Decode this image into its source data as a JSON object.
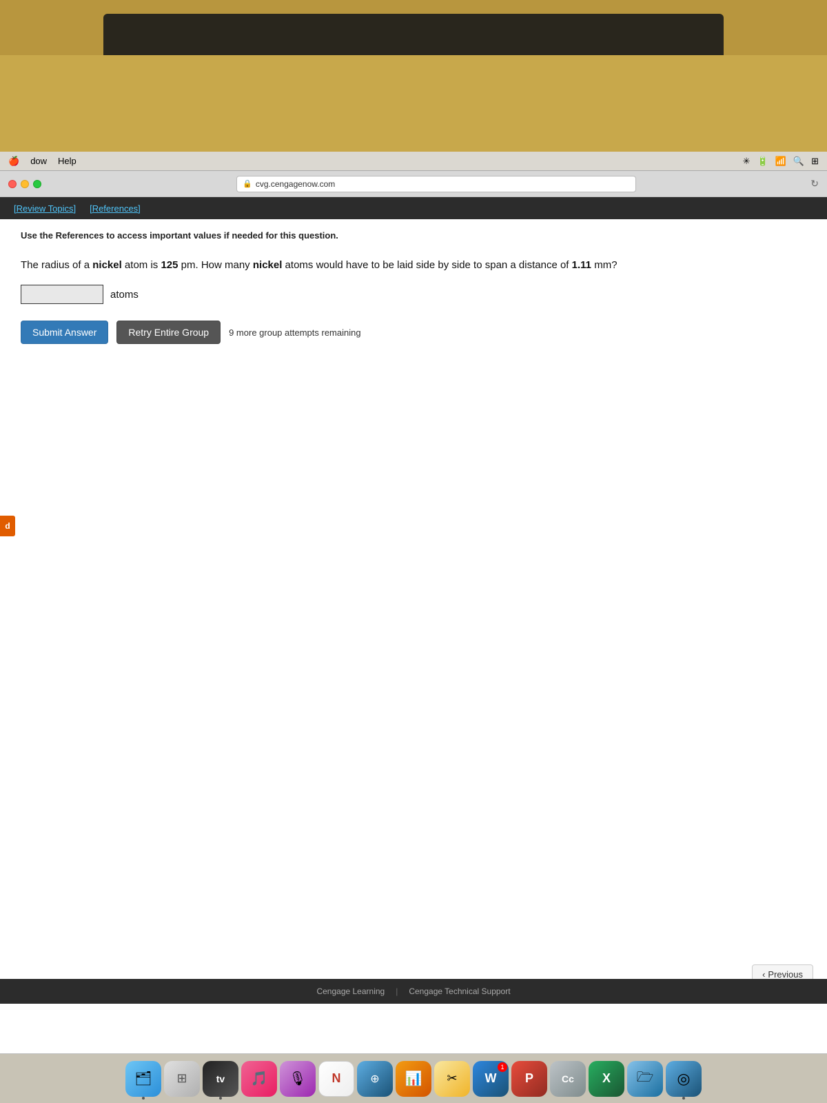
{
  "desktop": {
    "background_color": "#c8a84b"
  },
  "menubar": {
    "items": [
      "dow",
      "Help"
    ],
    "right_items": [
      "battery_icon",
      "wifi_icon",
      "search_icon",
      "control_center_icon"
    ]
  },
  "browser": {
    "address": "cvg.cengagenow.com",
    "nav_links": {
      "review_topics": "[Review Topics]",
      "references": "[References]"
    },
    "references_note": "Use the References to access important values if needed for this question.",
    "question": {
      "text_parts": {
        "intro": "The radius of a ",
        "nickel1": "nickel",
        "mid1": " atom is ",
        "value1": "125",
        "mid2": " pm. How many ",
        "nickel2": "nickel",
        "end": " atoms would have to be laid side by side to span a distance of ",
        "value2": "1.11",
        "unit": " mm?"
      },
      "full_text": "The radius of a nickel atom is 125 pm. How many nickel atoms would have to be laid side by side to span a distance of 1.11 mm?",
      "answer_placeholder": "",
      "atoms_label": "atoms"
    },
    "buttons": {
      "submit": "Submit Answer",
      "retry": "Retry Entire Group",
      "previous": "Previous"
    },
    "attempts_text": "9 more group attempts remaining",
    "footer": {
      "link1": "Cengage Learning",
      "separator": "|",
      "link2": "Cengage Technical Support"
    }
  },
  "dock": {
    "items": [
      {
        "name": "finder",
        "icon": "🗂",
        "label": "Finder"
      },
      {
        "name": "launchpad",
        "icon": "⊞",
        "label": "Launchpad"
      },
      {
        "name": "appletv",
        "icon": "📺",
        "label": "Apple TV",
        "text": "tv"
      },
      {
        "name": "music",
        "icon": "♫",
        "label": "Music"
      },
      {
        "name": "podcasts",
        "icon": "🎙",
        "label": "Podcasts"
      },
      {
        "name": "news",
        "icon": "N",
        "label": "News"
      },
      {
        "name": "translate",
        "icon": "⊞",
        "label": "Translate"
      },
      {
        "name": "charts",
        "icon": "📊",
        "label": "Charts"
      },
      {
        "name": "notes",
        "icon": "✂",
        "label": "Notes"
      },
      {
        "name": "word",
        "icon": "W",
        "label": "Word",
        "badge": ""
      },
      {
        "name": "powerpoint",
        "icon": "P",
        "label": "Powerpoint"
      },
      {
        "name": "cc",
        "icon": "Cc",
        "label": "CC"
      },
      {
        "name": "excel",
        "icon": "X",
        "label": "Excel"
      },
      {
        "name": "folder",
        "icon": "🗁",
        "label": "Folder"
      },
      {
        "name": "finder2",
        "icon": "◎",
        "label": "Safari",
        "dot": true
      }
    ]
  },
  "side_tab": {
    "letter": "d"
  }
}
